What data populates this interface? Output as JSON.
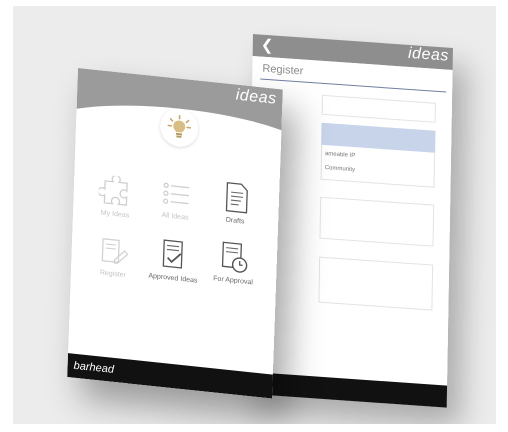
{
  "back_screen": {
    "back_icon": "chevron-left-icon",
    "brand": "ideas",
    "title": "Register",
    "options": [
      "ameable IP",
      "Community"
    ]
  },
  "front_screen": {
    "brand": "ideas",
    "center_icon": "lightbulb-icon",
    "tiles": [
      {
        "label": "My Ideas",
        "icon": "puzzle-icon"
      },
      {
        "label": "All Ideas",
        "icon": "list-icon"
      },
      {
        "label": "Drafts",
        "icon": "draft-document-icon"
      },
      {
        "label": "Register",
        "icon": "register-icon"
      },
      {
        "label": "Approved Ideas",
        "icon": "approved-document-icon"
      },
      {
        "label": "For Approval",
        "icon": "clock-document-icon"
      }
    ],
    "footer_logo": "barhead"
  },
  "colors": {
    "background": "#ececec",
    "header_gray": "#9b9b9b",
    "footer_black": "#111111",
    "highlight_blue": "#c8d4ea",
    "bulb_accent": "#c9a86a"
  }
}
